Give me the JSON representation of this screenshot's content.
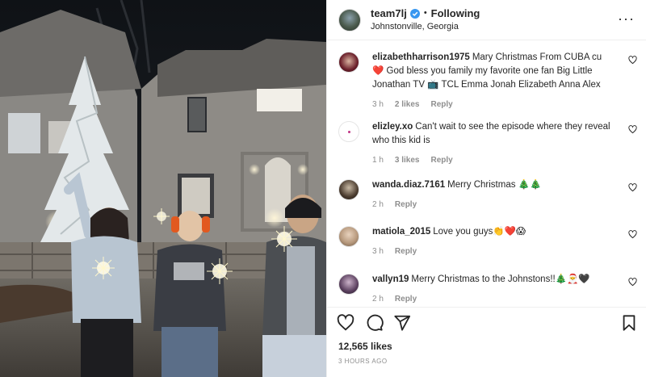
{
  "post": {
    "username": "team7lj",
    "follow_status": "Following",
    "location": "Johnstonville, Georgia"
  },
  "comments": [
    {
      "username": "elizabethharrison1975",
      "text": "Mary Christmas From CUBA cu ❤️ God bless you family my favorite one fan Big Little Jonathan TV 📺 TCL Emma Jonah Elizabeth Anna Alex",
      "time": "3 h",
      "likes": "2 likes",
      "reply": "Reply",
      "avatar_color": "#6b1f2a"
    },
    {
      "username": "elizley.xo",
      "text": "Can't wait to see the episode where they reveal who this kid is",
      "time": "1 h",
      "likes": "3 likes",
      "reply": "Reply",
      "avatar_color": "#ffffff"
    },
    {
      "username": "wanda.diaz.7161",
      "text": "Merry Christmas 🎄🎄",
      "time": "2 h",
      "likes": "",
      "reply": "Reply",
      "avatar_color": "#4a3b2e"
    },
    {
      "username": "matiola_2015",
      "text": "Love you guys👏❤️😱",
      "time": "3 h",
      "likes": "",
      "reply": "Reply",
      "avatar_color": "#b89a7e"
    },
    {
      "username": "vallyn19",
      "text": "Merry Christmas to the Johnstons!!🎄🎅🖤",
      "time": "2 h",
      "likes": "",
      "reply": "Reply",
      "avatar_color": "#5a3f5e"
    }
  ],
  "engagement": {
    "likes": "12,565 likes",
    "time_ago": "3 HOURS AGO"
  },
  "icons": {
    "like": "heart-icon",
    "comment": "comment-icon",
    "share": "share-icon",
    "save": "bookmark-icon",
    "more": "more-icon",
    "verified": "verified-badge-icon"
  },
  "colors": {
    "text": "#262626",
    "secondary": "#8e8e8e",
    "verified": "#3897f0",
    "divider": "#efefef"
  }
}
